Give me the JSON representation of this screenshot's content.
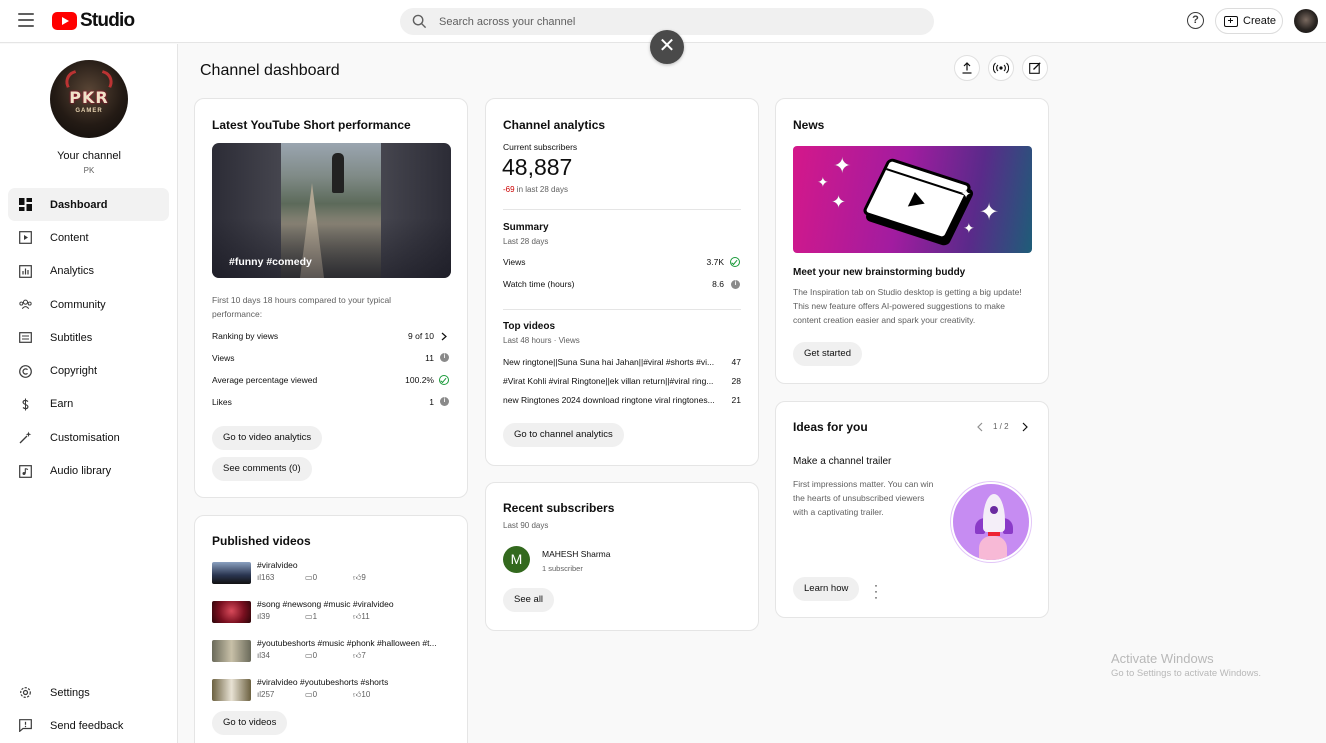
{
  "app": {
    "logo_text": "Studio"
  },
  "search": {
    "placeholder": "Search across your channel"
  },
  "header": {
    "create_label": "Create",
    "help_glyph": "?",
    "close_glyph": "✕"
  },
  "sidebar": {
    "avatar_text": "PKR",
    "avatar_subtext": "GAMER",
    "channel_label": "Your channel",
    "channel_name": "PK",
    "items": [
      {
        "label": "Dashboard",
        "icon": "dashboard-icon"
      },
      {
        "label": "Content",
        "icon": "content-icon"
      },
      {
        "label": "Analytics",
        "icon": "analytics-icon"
      },
      {
        "label": "Community",
        "icon": "community-icon"
      },
      {
        "label": "Subtitles",
        "icon": "subtitles-icon"
      },
      {
        "label": "Copyright",
        "icon": "copyright-icon"
      },
      {
        "label": "Earn",
        "icon": "earn-icon"
      },
      {
        "label": "Customisation",
        "icon": "customisation-icon"
      },
      {
        "label": "Audio library",
        "icon": "audio-library-icon"
      }
    ],
    "bottom_items": [
      {
        "label": "Settings",
        "icon": "gear-icon"
      },
      {
        "label": "Send feedback",
        "icon": "feedback-icon"
      }
    ]
  },
  "page": {
    "title": "Channel dashboard"
  },
  "short_perf": {
    "title": "Latest YouTube Short performance",
    "caption": "#funny #comedy",
    "note": "First 10 days 18 hours compared to your typical performance:",
    "rows": [
      {
        "label": "Ranking by views",
        "value": "9 of 10"
      },
      {
        "label": "Views",
        "value": "11"
      },
      {
        "label": "Average percentage viewed",
        "value": "100.2%"
      },
      {
        "label": "Likes",
        "value": "1"
      }
    ],
    "btn_analytics": "Go to video analytics",
    "btn_comments": "See comments (0)"
  },
  "published": {
    "title": "Published videos",
    "items": [
      {
        "title": "#viralvideo",
        "views": "163",
        "comments": "0",
        "likes": "9"
      },
      {
        "title": "#song #newsong #music #viralvideo",
        "views": "39",
        "comments": "1",
        "likes": "11"
      },
      {
        "title": "#youtubeshorts #music #phonk #halloween #t...",
        "views": "34",
        "comments": "0",
        "likes": "7"
      },
      {
        "title": "#viralvideo #youtubeshorts #shorts",
        "views": "257",
        "comments": "0",
        "likes": "10"
      }
    ],
    "btn": "Go to videos"
  },
  "analytics": {
    "title": "Channel analytics",
    "subs_label": "Current subscribers",
    "subs_value": "48,887",
    "subs_change": "-69",
    "subs_change_period": "in last 28 days",
    "summary_title": "Summary",
    "summary_period": "Last 28 days",
    "summary_rows": [
      {
        "label": "Views",
        "value": "3.7K"
      },
      {
        "label": "Watch time (hours)",
        "value": "8.6"
      }
    ],
    "top_title": "Top videos",
    "top_period": "Last 48 hours · Views",
    "top_rows": [
      {
        "label": "New ringtone||Suna Suna hai Jahan||#viral #shorts #vi...",
        "value": "47"
      },
      {
        "label": "#Virat Kohli #viral Ringtone||ek villan return||#viral ring...",
        "value": "28"
      },
      {
        "label": "new Ringtones 2024 download ringtone viral ringtones...",
        "value": "21"
      }
    ],
    "btn": "Go to channel analytics"
  },
  "recent_subs": {
    "title": "Recent subscribers",
    "period": "Last 90 days",
    "items": [
      {
        "initial": "M",
        "name": "MAHESH Sharma",
        "subs": "1 subscriber"
      }
    ],
    "btn": "See all"
  },
  "news": {
    "title": "News",
    "headline": "Meet your new brainstorming buddy",
    "body": "The Inspiration tab on Studio desktop is getting a big update! This new feature offers AI-powered suggestions to make content creation easier and spark your creativity.",
    "btn": "Get started"
  },
  "ideas": {
    "title": "Ideas for you",
    "pager": "1 / 2",
    "headline": "Make a channel trailer",
    "body": "First impressions matter. You can win the hearts of unsubscribed viewers with a captivating trailer.",
    "btn": "Learn how"
  },
  "watermark": {
    "line1": "Activate Windows",
    "line2": "Go to Settings to activate Windows."
  },
  "colors": {
    "brand_red": "#ff0000",
    "negative": "#cc0000",
    "positive": "#1a9a3a"
  }
}
